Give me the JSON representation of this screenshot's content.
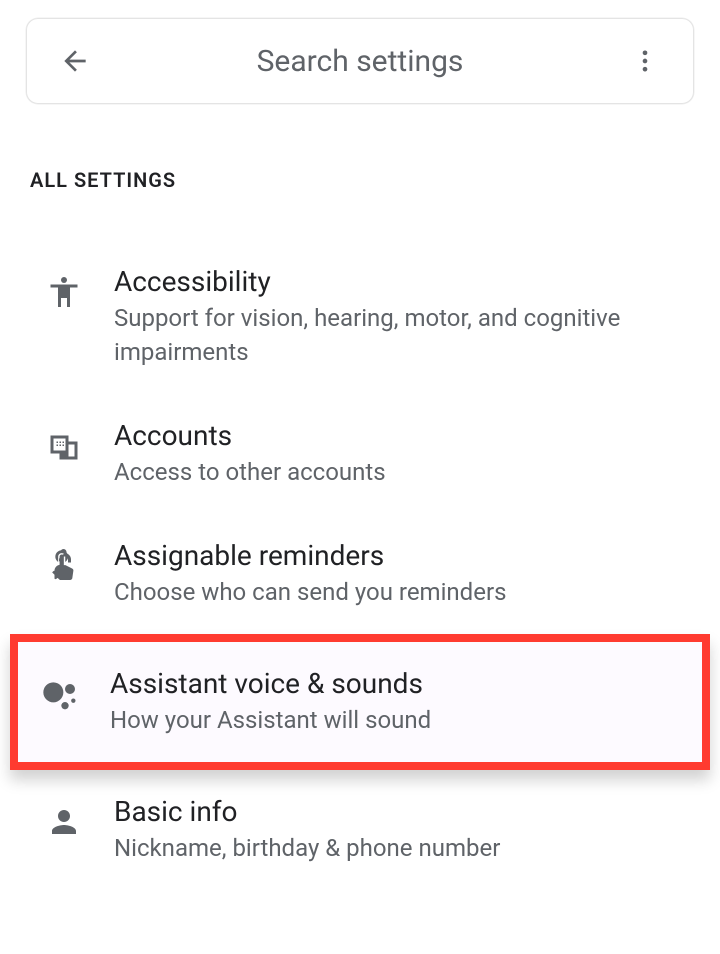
{
  "header": {
    "search_placeholder": "Search settings"
  },
  "section": {
    "title": "ALL SETTINGS"
  },
  "items": [
    {
      "icon": "accessibility-icon",
      "title": "Accessibility",
      "desc": "Support for vision, hearing, motor, and cognitive impairments",
      "highlighted": false
    },
    {
      "icon": "accounts-icon",
      "title": "Accounts",
      "desc": "Access to other accounts",
      "highlighted": false
    },
    {
      "icon": "reminders-icon",
      "title": "Assignable reminders",
      "desc": "Choose who can send you reminders",
      "highlighted": false
    },
    {
      "icon": "assistant-voice-icon",
      "title": "Assistant voice & sounds",
      "desc": "How your Assistant will sound",
      "highlighted": true
    },
    {
      "icon": "basic-info-icon",
      "title": "Basic info",
      "desc": "Nickname, birthday & phone number",
      "highlighted": false
    }
  ]
}
